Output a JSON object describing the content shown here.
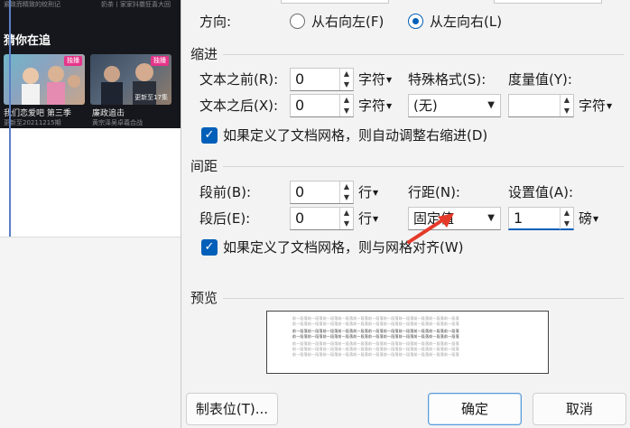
{
  "background_app": {
    "top_strip": [
      "紧致而精致的绞刑记",
      "奶茶丨家家抖擞狂喜大回"
    ],
    "heading": "猜你在追",
    "cards": [
      {
        "title": "我们恋爱吧 第三季",
        "subtitle": "更新至20211215期",
        "badge": "独播",
        "episode": ""
      },
      {
        "title": "廉政追击",
        "subtitle": "黄宗泽吴卓羲合战",
        "badge": "独播",
        "episode": "更新至17集"
      }
    ]
  },
  "dialog": {
    "direction": {
      "label": "方向:",
      "options": [
        {
          "label": "从右向左(F)",
          "selected": false
        },
        {
          "label": "从左向右(L)",
          "selected": true
        }
      ]
    },
    "indent": {
      "section_title": "缩进",
      "before_text_label": "文本之前(R):",
      "before_text_value": "0",
      "before_text_unit": "字符",
      "after_text_label": "文本之后(X):",
      "after_text_value": "0",
      "after_text_unit": "字符",
      "special_format_label": "特殊格式(S):",
      "special_format_value": "(无)",
      "measure_label": "度量值(Y):",
      "measure_value": "",
      "measure_unit": "字符",
      "auto_adjust_checked": true,
      "auto_adjust_label": "如果定义了文档网格，则自动调整右缩进(D)"
    },
    "spacing": {
      "section_title": "间距",
      "before_label": "段前(B):",
      "before_value": "0",
      "before_unit": "行",
      "after_label": "段后(E):",
      "after_value": "0",
      "after_unit": "行",
      "line_spacing_label": "行距(N):",
      "line_spacing_value": "固定值",
      "set_value_label": "设置值(A):",
      "set_value": "1",
      "set_value_unit": "磅",
      "grid_align_checked": true,
      "grid_align_label": "如果定义了文档网格，则与网格对齐(W)"
    },
    "preview": {
      "section_title": "预览",
      "sample_text": "前一段落前一段落前一段落前一段落前一段落前一段落前一段落前一段落前一段落前一段落前一段落"
    },
    "buttons": {
      "tabs_label": "制表位(T)...",
      "ok_label": "确定",
      "cancel_label": "取消"
    }
  },
  "colors": {
    "accent": "#005fb8",
    "annotation_arrow": "#e53a2a",
    "dialog_bg": "#f3f3f3",
    "bg_app_dark": "#16171c"
  }
}
